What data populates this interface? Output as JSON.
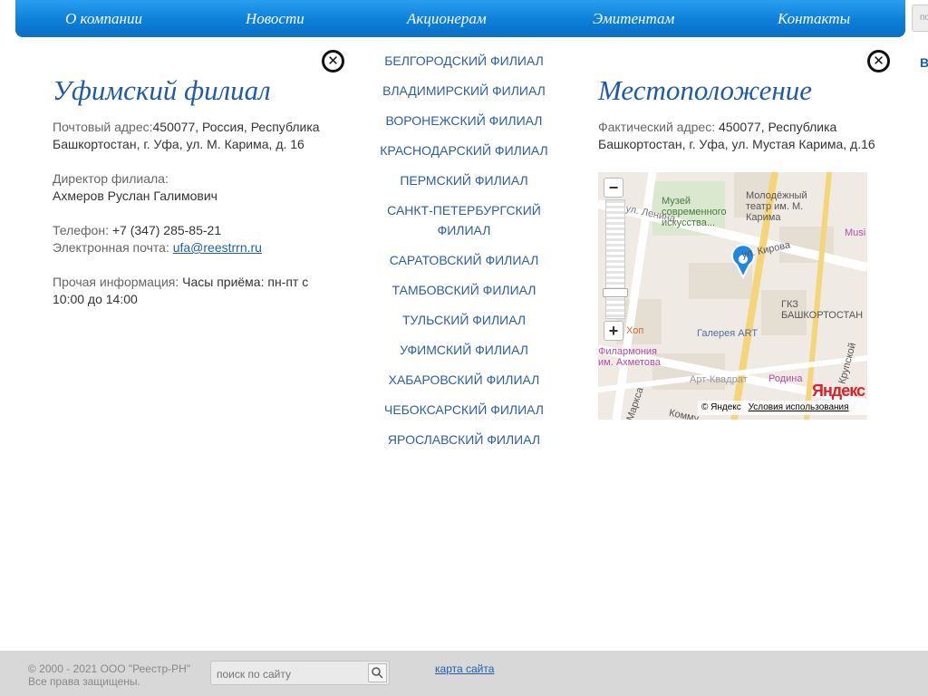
{
  "nav": {
    "items": [
      {
        "label": "О компании"
      },
      {
        "label": "Новости"
      },
      {
        "label": "Акционерам"
      },
      {
        "label": "Эмитентам"
      },
      {
        "label": "Контакты"
      }
    ],
    "search_placeholder": "по",
    "edge_letter": "В"
  },
  "branch": {
    "title": "Уфимский филиал",
    "postal_label": "Почтовый адрес:",
    "postal_value": "450077, Россия, Республика Башкортостан, г. Уфа, ул. М. Карима, д. 16",
    "director_label": "Директор филиала:",
    "director_value": "Ахмеров Руслан Галимович",
    "phone_label": "Телефон:",
    "phone_value": "+7 (347) 285-85-21",
    "email_label": "Электронная почта:",
    "email_value": "ufa@reestrrn.ru",
    "other_label": "Прочая информация:",
    "other_value": "Часы приёма: пн-пт с 10:00 до 14:00"
  },
  "branches": [
    "Белгородский филиал",
    "Владимирский филиал",
    "Воронежский филиал",
    "Краснодарский филиал",
    "Пермский филиал",
    "Санкт-Петербургский филиал",
    "Саратовский филиал",
    "Тамбовский филиал",
    "Тульский филиал",
    "Уфимский филиал",
    "Хабаровский филиал",
    "Чебоксарский филиал",
    "Ярославский филиал"
  ],
  "location": {
    "title": "Местоположение",
    "address_label": "Фактический адрес:",
    "address_value": "450077, Республика Башкортостан, г. Уфа, ул. Мустая Карима, д.16"
  },
  "map": {
    "labels": {
      "museum": "Музей современного искусства...",
      "theatre": "Молодёжный театр им. М. Карима",
      "music": "Musi",
      "kirova": "ул. Кирова",
      "gkz": "ГКЗ БАШКОРТОСТАН",
      "hop": "Хоп",
      "gallery": "Галерея ART",
      "philharmonic": "Филармония им. Ахметова",
      "art_square": "Арт-Квадрат",
      "rodina": "Родина",
      "krupskoy": "Крупской",
      "marksa": "Маркса",
      "kommun": "Комму",
      "lenina": "ул. Ленина"
    },
    "logo": "Яндекс",
    "copyright": "© Яндекс",
    "terms": "Условия использования",
    "zoom_in": "+",
    "zoom_out": "−"
  },
  "footer": {
    "copyright_line1": "© 2000 - 2021  ООО \"Реестр-РН\"",
    "copyright_line2": "Все права защищены.",
    "search_placeholder": "поиск по сайту",
    "sitemap": "карта сайта"
  }
}
